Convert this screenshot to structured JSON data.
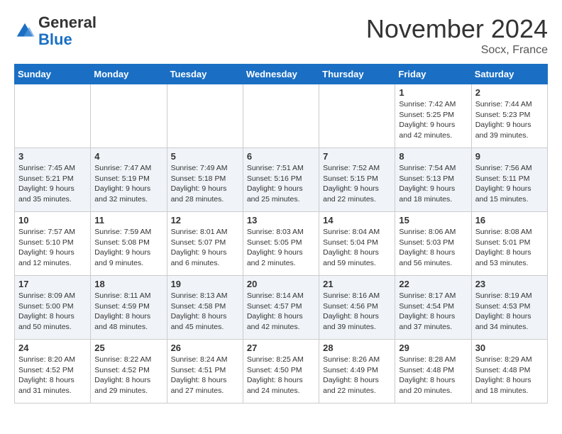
{
  "logo": {
    "general": "General",
    "blue": "Blue"
  },
  "title": "November 2024",
  "location": "Socx, France",
  "days_of_week": [
    "Sunday",
    "Monday",
    "Tuesday",
    "Wednesday",
    "Thursday",
    "Friday",
    "Saturday"
  ],
  "weeks": [
    [
      {
        "day": "",
        "info": ""
      },
      {
        "day": "",
        "info": ""
      },
      {
        "day": "",
        "info": ""
      },
      {
        "day": "",
        "info": ""
      },
      {
        "day": "",
        "info": ""
      },
      {
        "day": "1",
        "info": "Sunrise: 7:42 AM\nSunset: 5:25 PM\nDaylight: 9 hours\nand 42 minutes."
      },
      {
        "day": "2",
        "info": "Sunrise: 7:44 AM\nSunset: 5:23 PM\nDaylight: 9 hours\nand 39 minutes."
      }
    ],
    [
      {
        "day": "3",
        "info": "Sunrise: 7:45 AM\nSunset: 5:21 PM\nDaylight: 9 hours\nand 35 minutes."
      },
      {
        "day": "4",
        "info": "Sunrise: 7:47 AM\nSunset: 5:19 PM\nDaylight: 9 hours\nand 32 minutes."
      },
      {
        "day": "5",
        "info": "Sunrise: 7:49 AM\nSunset: 5:18 PM\nDaylight: 9 hours\nand 28 minutes."
      },
      {
        "day": "6",
        "info": "Sunrise: 7:51 AM\nSunset: 5:16 PM\nDaylight: 9 hours\nand 25 minutes."
      },
      {
        "day": "7",
        "info": "Sunrise: 7:52 AM\nSunset: 5:15 PM\nDaylight: 9 hours\nand 22 minutes."
      },
      {
        "day": "8",
        "info": "Sunrise: 7:54 AM\nSunset: 5:13 PM\nDaylight: 9 hours\nand 18 minutes."
      },
      {
        "day": "9",
        "info": "Sunrise: 7:56 AM\nSunset: 5:11 PM\nDaylight: 9 hours\nand 15 minutes."
      }
    ],
    [
      {
        "day": "10",
        "info": "Sunrise: 7:57 AM\nSunset: 5:10 PM\nDaylight: 9 hours\nand 12 minutes."
      },
      {
        "day": "11",
        "info": "Sunrise: 7:59 AM\nSunset: 5:08 PM\nDaylight: 9 hours\nand 9 minutes."
      },
      {
        "day": "12",
        "info": "Sunrise: 8:01 AM\nSunset: 5:07 PM\nDaylight: 9 hours\nand 6 minutes."
      },
      {
        "day": "13",
        "info": "Sunrise: 8:03 AM\nSunset: 5:05 PM\nDaylight: 9 hours\nand 2 minutes."
      },
      {
        "day": "14",
        "info": "Sunrise: 8:04 AM\nSunset: 5:04 PM\nDaylight: 8 hours\nand 59 minutes."
      },
      {
        "day": "15",
        "info": "Sunrise: 8:06 AM\nSunset: 5:03 PM\nDaylight: 8 hours\nand 56 minutes."
      },
      {
        "day": "16",
        "info": "Sunrise: 8:08 AM\nSunset: 5:01 PM\nDaylight: 8 hours\nand 53 minutes."
      }
    ],
    [
      {
        "day": "17",
        "info": "Sunrise: 8:09 AM\nSunset: 5:00 PM\nDaylight: 8 hours\nand 50 minutes."
      },
      {
        "day": "18",
        "info": "Sunrise: 8:11 AM\nSunset: 4:59 PM\nDaylight: 8 hours\nand 48 minutes."
      },
      {
        "day": "19",
        "info": "Sunrise: 8:13 AM\nSunset: 4:58 PM\nDaylight: 8 hours\nand 45 minutes."
      },
      {
        "day": "20",
        "info": "Sunrise: 8:14 AM\nSunset: 4:57 PM\nDaylight: 8 hours\nand 42 minutes."
      },
      {
        "day": "21",
        "info": "Sunrise: 8:16 AM\nSunset: 4:56 PM\nDaylight: 8 hours\nand 39 minutes."
      },
      {
        "day": "22",
        "info": "Sunrise: 8:17 AM\nSunset: 4:54 PM\nDaylight: 8 hours\nand 37 minutes."
      },
      {
        "day": "23",
        "info": "Sunrise: 8:19 AM\nSunset: 4:53 PM\nDaylight: 8 hours\nand 34 minutes."
      }
    ],
    [
      {
        "day": "24",
        "info": "Sunrise: 8:20 AM\nSunset: 4:52 PM\nDaylight: 8 hours\nand 31 minutes."
      },
      {
        "day": "25",
        "info": "Sunrise: 8:22 AM\nSunset: 4:52 PM\nDaylight: 8 hours\nand 29 minutes."
      },
      {
        "day": "26",
        "info": "Sunrise: 8:24 AM\nSunset: 4:51 PM\nDaylight: 8 hours\nand 27 minutes."
      },
      {
        "day": "27",
        "info": "Sunrise: 8:25 AM\nSunset: 4:50 PM\nDaylight: 8 hours\nand 24 minutes."
      },
      {
        "day": "28",
        "info": "Sunrise: 8:26 AM\nSunset: 4:49 PM\nDaylight: 8 hours\nand 22 minutes."
      },
      {
        "day": "29",
        "info": "Sunrise: 8:28 AM\nSunset: 4:48 PM\nDaylight: 8 hours\nand 20 minutes."
      },
      {
        "day": "30",
        "info": "Sunrise: 8:29 AM\nSunset: 4:48 PM\nDaylight: 8 hours\nand 18 minutes."
      }
    ]
  ]
}
